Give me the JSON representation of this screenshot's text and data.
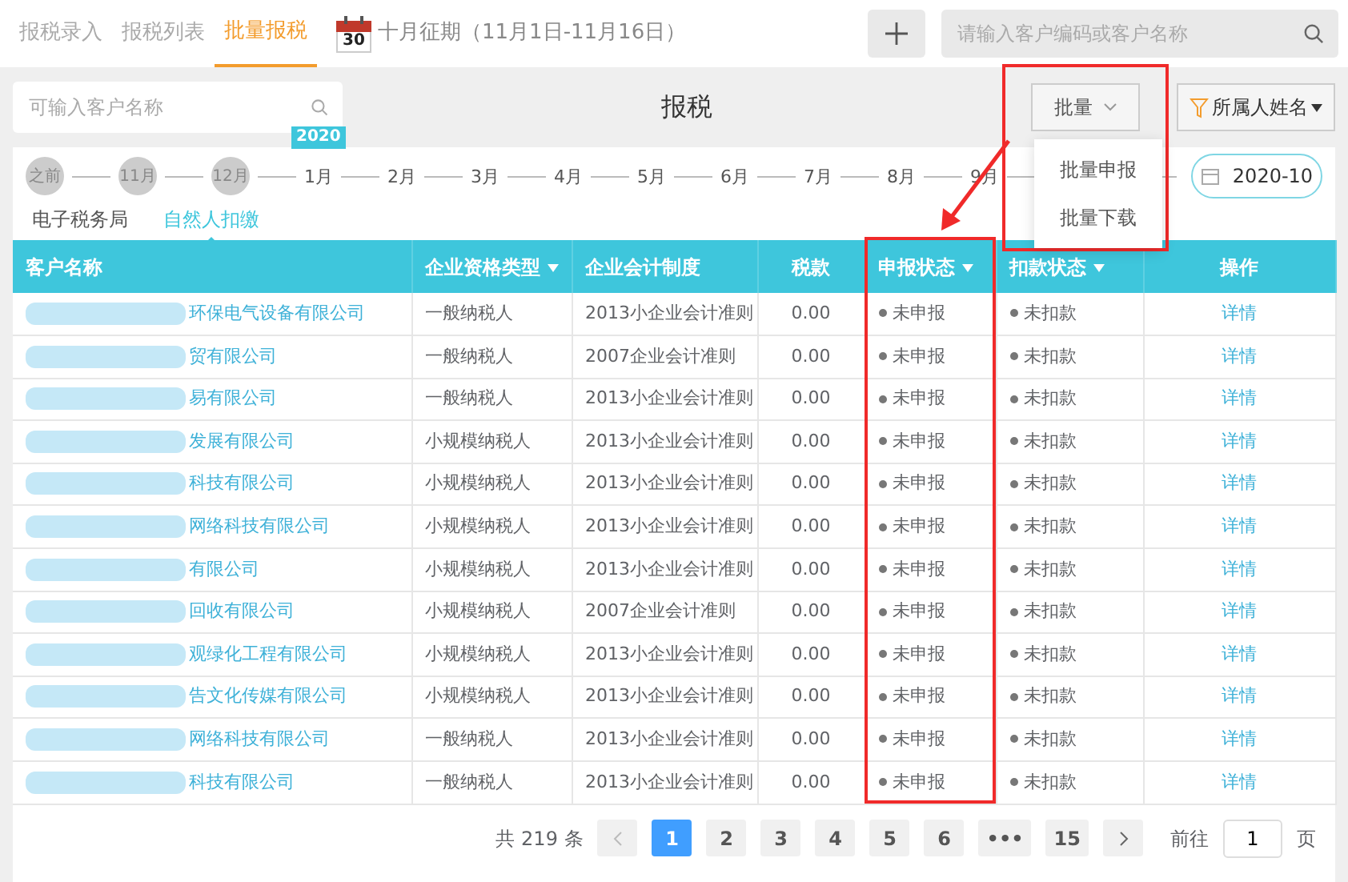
{
  "top_tabs": [
    {
      "label": "报税录入",
      "selected": false
    },
    {
      "label": "报税列表",
      "selected": false
    },
    {
      "label": "批量报税",
      "selected": true
    }
  ],
  "calendar_day": "30",
  "period": "十月征期（11月1日-11月16日）",
  "global_search": {
    "placeholder": "请输入客户编码或客户名称"
  },
  "customer_search": {
    "placeholder": "可输入客户名称"
  },
  "title": "报税",
  "batch_button": "批量",
  "batch_menu": {
    "expanded": true,
    "items": [
      "批量申报",
      "批量下载"
    ]
  },
  "filter_button": "所属人姓名",
  "timeline": [
    {
      "label": "之前",
      "done": true
    },
    {
      "label": "11月",
      "done": true
    },
    {
      "label": "12月",
      "done": true
    },
    {
      "label": "1月",
      "done": false,
      "badge": "2020"
    },
    {
      "label": "2月",
      "done": false
    },
    {
      "label": "3月",
      "done": false
    },
    {
      "label": "4月",
      "done": false
    },
    {
      "label": "5月",
      "done": false
    },
    {
      "label": "6月",
      "done": false
    },
    {
      "label": "7月",
      "done": false
    },
    {
      "label": "8月",
      "done": false
    },
    {
      "label": "9月",
      "done": false
    }
  ],
  "date_field": "2020-10",
  "sub_tabs": [
    {
      "label": "电子税务局",
      "selected": false
    },
    {
      "label": "自然人扣缴",
      "selected": true
    }
  ],
  "table": {
    "columns": [
      {
        "label": "客户名称",
        "sortable": false
      },
      {
        "label": "企业资格类型",
        "sortable": true
      },
      {
        "label": "企业会计制度",
        "sortable": false
      },
      {
        "label": "税款",
        "sortable": false
      },
      {
        "label": "申报状态",
        "sortable": true
      },
      {
        "label": "扣款状态",
        "sortable": true
      },
      {
        "label": "操作",
        "sortable": false
      }
    ],
    "rows": [
      {
        "name": "环保电气设备有限公司",
        "type": "一般纳税人",
        "accounting": "2013小企业会计准则",
        "tax": "0.00",
        "declare": "未申报",
        "deduct": "未扣款",
        "action": "详情"
      },
      {
        "name": "贸有限公司",
        "type": "一般纳税人",
        "accounting": "2007企业会计准则",
        "tax": "0.00",
        "declare": "未申报",
        "deduct": "未扣款",
        "action": "详情"
      },
      {
        "name": "易有限公司",
        "type": "一般纳税人",
        "accounting": "2013小企业会计准则",
        "tax": "0.00",
        "declare": "未申报",
        "deduct": "未扣款",
        "action": "详情"
      },
      {
        "name": "发展有限公司",
        "type": "小规模纳税人",
        "accounting": "2013小企业会计准则",
        "tax": "0.00",
        "declare": "未申报",
        "deduct": "未扣款",
        "action": "详情"
      },
      {
        "name": "科技有限公司",
        "type": "小规模纳税人",
        "accounting": "2013小企业会计准则",
        "tax": "0.00",
        "declare": "未申报",
        "deduct": "未扣款",
        "action": "详情"
      },
      {
        "name": "网络科技有限公司",
        "type": "小规模纳税人",
        "accounting": "2013小企业会计准则",
        "tax": "0.00",
        "declare": "未申报",
        "deduct": "未扣款",
        "action": "详情"
      },
      {
        "name": "有限公司",
        "type": "小规模纳税人",
        "accounting": "2013小企业会计准则",
        "tax": "0.00",
        "declare": "未申报",
        "deduct": "未扣款",
        "action": "详情"
      },
      {
        "name": "回收有限公司",
        "type": "小规模纳税人",
        "accounting": "2007企业会计准则",
        "tax": "0.00",
        "declare": "未申报",
        "deduct": "未扣款",
        "action": "详情"
      },
      {
        "name": "观绿化工程有限公司",
        "type": "小规模纳税人",
        "accounting": "2013小企业会计准则",
        "tax": "0.00",
        "declare": "未申报",
        "deduct": "未扣款",
        "action": "详情"
      },
      {
        "name": "告文化传媒有限公司",
        "type": "小规模纳税人",
        "accounting": "2013小企业会计准则",
        "tax": "0.00",
        "declare": "未申报",
        "deduct": "未扣款",
        "action": "详情"
      },
      {
        "name": "网络科技有限公司",
        "type": "一般纳税人",
        "accounting": "2013小企业会计准则",
        "tax": "0.00",
        "declare": "未申报",
        "deduct": "未扣款",
        "action": "详情"
      },
      {
        "name": "科技有限公司",
        "type": "一般纳税人",
        "accounting": "2013小企业会计准则",
        "tax": "0.00",
        "declare": "未申报",
        "deduct": "未扣款",
        "action": "详情"
      }
    ]
  },
  "pagination": {
    "total": "共 219 条",
    "pages": [
      {
        "label": "1",
        "selected": true
      },
      {
        "label": "2",
        "selected": false
      },
      {
        "label": "3",
        "selected": false
      },
      {
        "label": "4",
        "selected": false
      },
      {
        "label": "5",
        "selected": false
      },
      {
        "label": "6",
        "selected": false
      },
      {
        "label": "•••",
        "selected": false
      },
      {
        "label": "15",
        "selected": false
      }
    ],
    "goto_label": "前往",
    "goto_value": "1",
    "goto_unit": "页"
  },
  "annotations": [
    {
      "kind": "menu_highlight"
    },
    {
      "kind": "column_highlight"
    },
    {
      "kind": "arrow"
    }
  ]
}
